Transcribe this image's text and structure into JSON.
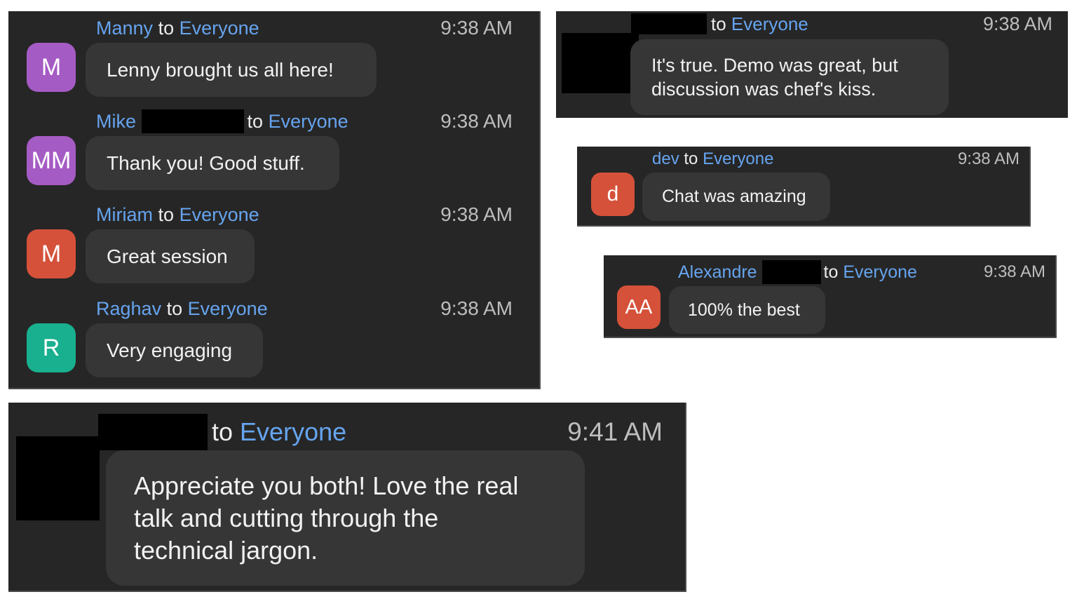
{
  "panel1": {
    "messages": [
      {
        "sender": "Manny",
        "to_word": "to",
        "recipient": "Everyone",
        "time": "9:38 AM",
        "avatar_text": "M",
        "avatar_color": "#a55bc4",
        "text": "Lenny brought us all here!"
      },
      {
        "sender": "Mike",
        "to_word": "to",
        "recipient": "Everyone",
        "time": "9:38 AM",
        "avatar_text": "MM",
        "avatar_color": "#a55bc4",
        "text": "Thank you! Good stuff."
      },
      {
        "sender": "Miriam",
        "to_word": "to",
        "recipient": "Everyone",
        "time": "9:38 AM",
        "avatar_text": "M",
        "avatar_color": "#d5513a",
        "text": "Great session"
      },
      {
        "sender": "Raghav",
        "to_word": "to",
        "recipient": "Everyone",
        "time": "9:38 AM",
        "avatar_text": "R",
        "avatar_color": "#19b08f",
        "text": "Very engaging"
      }
    ]
  },
  "panel2": {
    "to_word": "to",
    "recipient": "Everyone",
    "time": "9:38 AM",
    "text_line1": "It's true. Demo was great, but",
    "text_line2": "discussion was chef's kiss."
  },
  "panel3": {
    "sender": "dev",
    "to_word": "to",
    "recipient": "Everyone",
    "time": "9:38 AM",
    "avatar_text": "d",
    "avatar_color": "#d5513a",
    "text": "Chat was amazing"
  },
  "panel4": {
    "sender": "Alexandre",
    "to_word": "to",
    "recipient": "Everyone",
    "time": "9:38 AM",
    "avatar_text": "AA",
    "avatar_color": "#d5513a",
    "text": "100% the best"
  },
  "panel5": {
    "to_word": "to",
    "recipient": "Everyone",
    "time": "9:41 AM",
    "text_line1": "Appreciate you both! Love the real",
    "text_line2": "talk and cutting through the",
    "text_line3": "technical jargon."
  },
  "colors": {
    "panel_bg": "#262626",
    "bubble_bg": "#363636",
    "link_blue": "#66a4ef",
    "redaction": "#000000"
  }
}
